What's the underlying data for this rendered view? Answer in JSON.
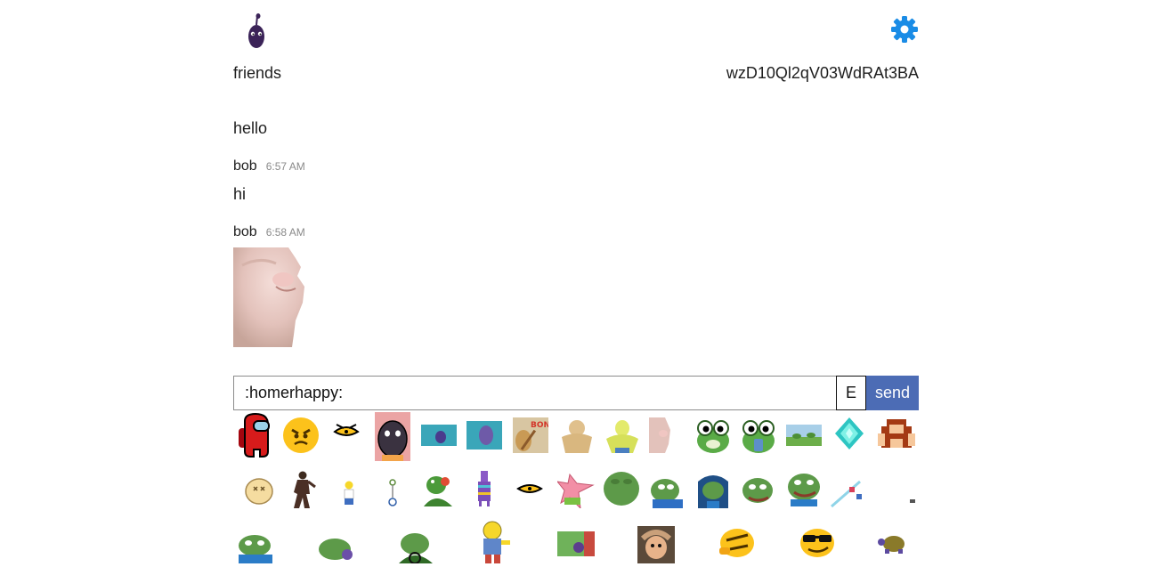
{
  "header": {
    "channel_name": "friends",
    "room_id": "wzD10Ql2qV03WdRAt3BA"
  },
  "messages": [
    {
      "text": "hello"
    },
    {
      "author": "bob",
      "time": "6:57 AM",
      "text": "hi"
    },
    {
      "author": "bob",
      "time": "6:58 AM",
      "image": "cat-closeup"
    }
  ],
  "composer": {
    "input_value": ":homerhappy:",
    "emoji_button_label": "E",
    "send_label": "send"
  },
  "emoji_picker": {
    "row1": [
      "among-us",
      "angry-face",
      "slit-eye-emote",
      "purple-blob-pink",
      "blob-teal-small",
      "blob-teal",
      "bonk-doge",
      "buff-doge",
      "yellow-buff",
      "cat-sniff",
      "frog-cute",
      "frog-sip",
      "frog-field",
      "diamond",
      "donkey-kong"
    ],
    "row2": [
      "potato-face",
      "dancer",
      "homer-small",
      "key-figure",
      "kermit-tea",
      "llama-pinata",
      "eye-emote",
      "patrick-point",
      "pepe-blob",
      "pepe-cry",
      "pepe-hoodie",
      "pepe-smile",
      "pepe-happy",
      "sword-pixel",
      "tiny-dot"
    ],
    "row3": [
      "pepe-sad",
      "pepe-peek",
      "pepe-drive",
      "ralph",
      "scene-blob",
      "toad",
      "thinking-smirk",
      "cool-shades",
      "turtle"
    ]
  },
  "colors": {
    "accent_send": "#4c6cb5",
    "gear": "#1a8ce6",
    "logo": "#3b2358",
    "timestamp": "#8a8a8a"
  }
}
